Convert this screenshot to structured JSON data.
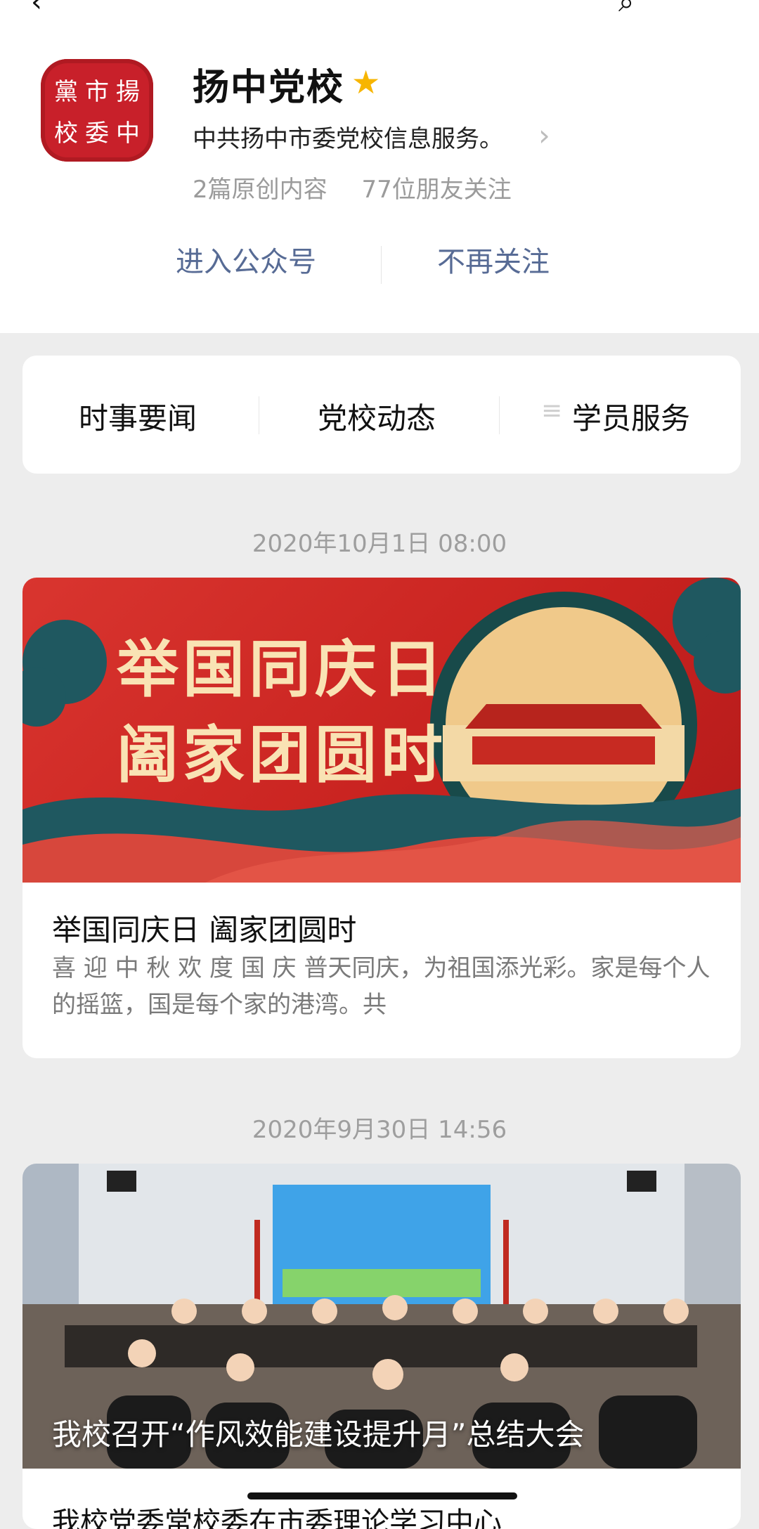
{
  "account": {
    "avatar_chars": [
      "黨",
      "市",
      "揚",
      "校",
      "委",
      "中"
    ],
    "name": "扬中党校",
    "description": "中共扬中市委党校信息服务。",
    "stats": [
      "2篇原创内容",
      "77位朋友关注"
    ]
  },
  "actions": {
    "enter": "进入公众号",
    "unfollow": "不再关注"
  },
  "menu": [
    "时事要闻",
    "党校动态",
    "学员服务"
  ],
  "posts": [
    {
      "timestamp": "2020年10月1日 08:00",
      "banner_lines": [
        "举国同庆日",
        "阖家团圆时"
      ],
      "title": "举国同庆日 阖家团圆时",
      "digest": "喜 迎 中 秋   欢 度 国 庆   普天同庆，为祖国添光彩。家是每个人的摇篮，国是每个家的港湾。共"
    },
    {
      "timestamp": "2020年9月30日 14:56",
      "image_caption": "我校召开“作风效能建设提升月”总结大会",
      "next_title": "我校党委常校委在市委理论学习中心"
    }
  ],
  "colors": {
    "link": "#576b95",
    "star": "#f7b500",
    "seal": "#c8202a"
  },
  "icons": [
    "back-icon",
    "search-icon",
    "star-icon",
    "chevron-right-icon",
    "menu-icon"
  ]
}
